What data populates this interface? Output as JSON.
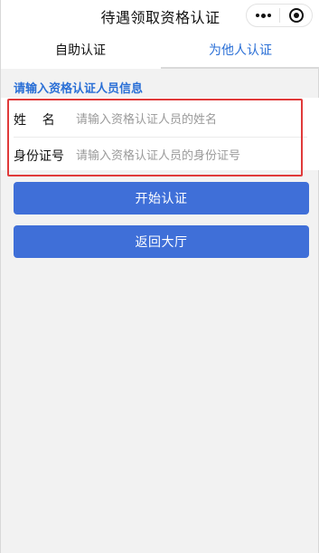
{
  "title": "待遇领取资格认证",
  "capsule": {
    "more_icon": "more-dots-icon",
    "close_icon": "target-close-icon"
  },
  "tabs": [
    {
      "label": "自助认证",
      "active": true
    },
    {
      "label": "为他人认证",
      "active": false
    }
  ],
  "colors": {
    "accent": "#2a6fd6",
    "button": "#3f6fd8",
    "highlight": "#e03a3a",
    "background": "#f2f2f2"
  },
  "form": {
    "section_title": "请输入资格认证人员信息",
    "name": {
      "label": "姓    名",
      "value": "",
      "placeholder": "请输入资格认证人员的姓名"
    },
    "id_number": {
      "label": "身份证号",
      "value": "",
      "placeholder": "请输入资格认证人员的身份证号"
    }
  },
  "buttons": {
    "start": "开始认证",
    "back": "返回大厅"
  }
}
